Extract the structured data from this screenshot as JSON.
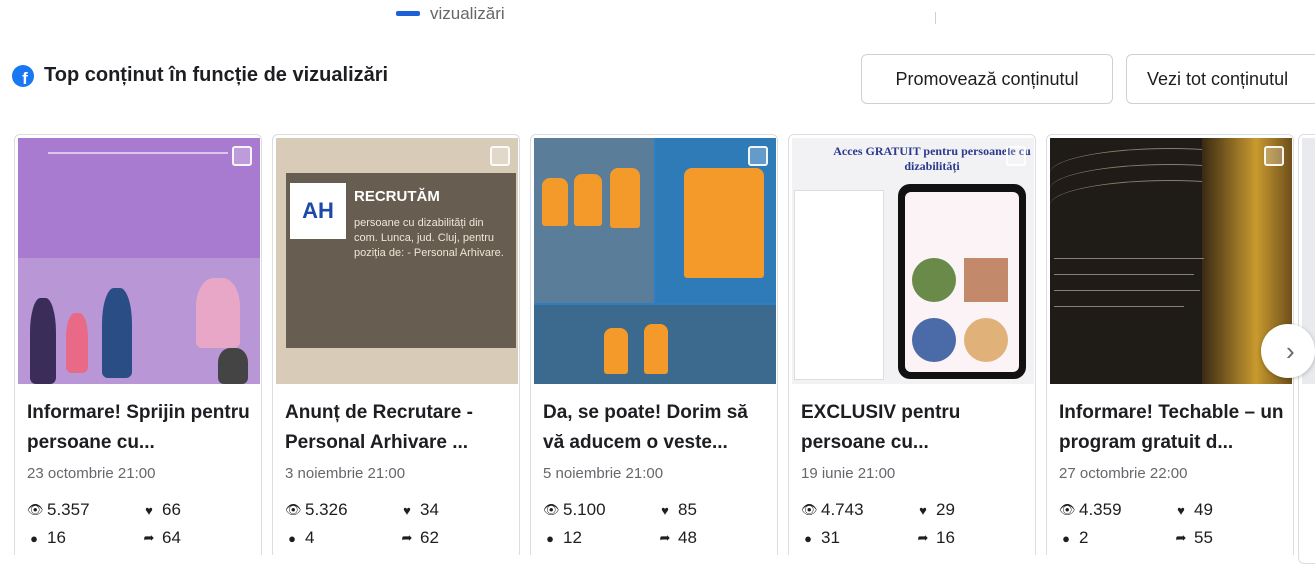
{
  "legend": {
    "label": "vizualizări"
  },
  "section": {
    "title": "Top conținut în funcție de vizualizări"
  },
  "buttons": {
    "promote": "Promovează conținutul",
    "view_all": "Vezi tot conținutul"
  },
  "thumb_texts": {
    "card2_logo": "AH",
    "card2_heading": "RECRUTĂM",
    "card2_body": "persoane cu dizabilități din com. Lunca, jud. Cluj, pentru poziția de: - Personal Arhivare.",
    "card4_heading": "Acces GRATUIT pentru persoanele cu dizabilități"
  },
  "cards": [
    {
      "title": "Informare! Sprijin pentru persoane cu...",
      "date": "23 octombrie 21:00",
      "views": "5.357",
      "reactions": "66",
      "comments": "16",
      "shares": "64"
    },
    {
      "title": "Anunț de Recrutare - Personal Arhivare ...",
      "date": "3 noiembrie 21:00",
      "views": "5.326",
      "reactions": "34",
      "comments": "4",
      "shares": "62"
    },
    {
      "title": "Da, se poate! Dorim să vă aducem o veste...",
      "date": "5 noiembrie 21:00",
      "views": "5.100",
      "reactions": "85",
      "comments": "12",
      "shares": "48"
    },
    {
      "title": "EXCLUSIV pentru persoane cu...",
      "date": "19 iunie 21:00",
      "views": "4.743",
      "reactions": "29",
      "comments": "31",
      "shares": "16"
    },
    {
      "title": "Informare! Techable – un program gratuit d...",
      "date": "27 octombrie 22:00",
      "views": "4.359",
      "reactions": "49",
      "comments": "2",
      "shares": "55"
    }
  ],
  "colors": {
    "accent": "#1877f2",
    "legend_swatch": "#1d5fd6"
  },
  "icons": {
    "views": "eye-icon",
    "reactions": "heart-icon",
    "comments": "comment-icon",
    "shares": "share-icon",
    "next": "chevron-right-icon"
  }
}
